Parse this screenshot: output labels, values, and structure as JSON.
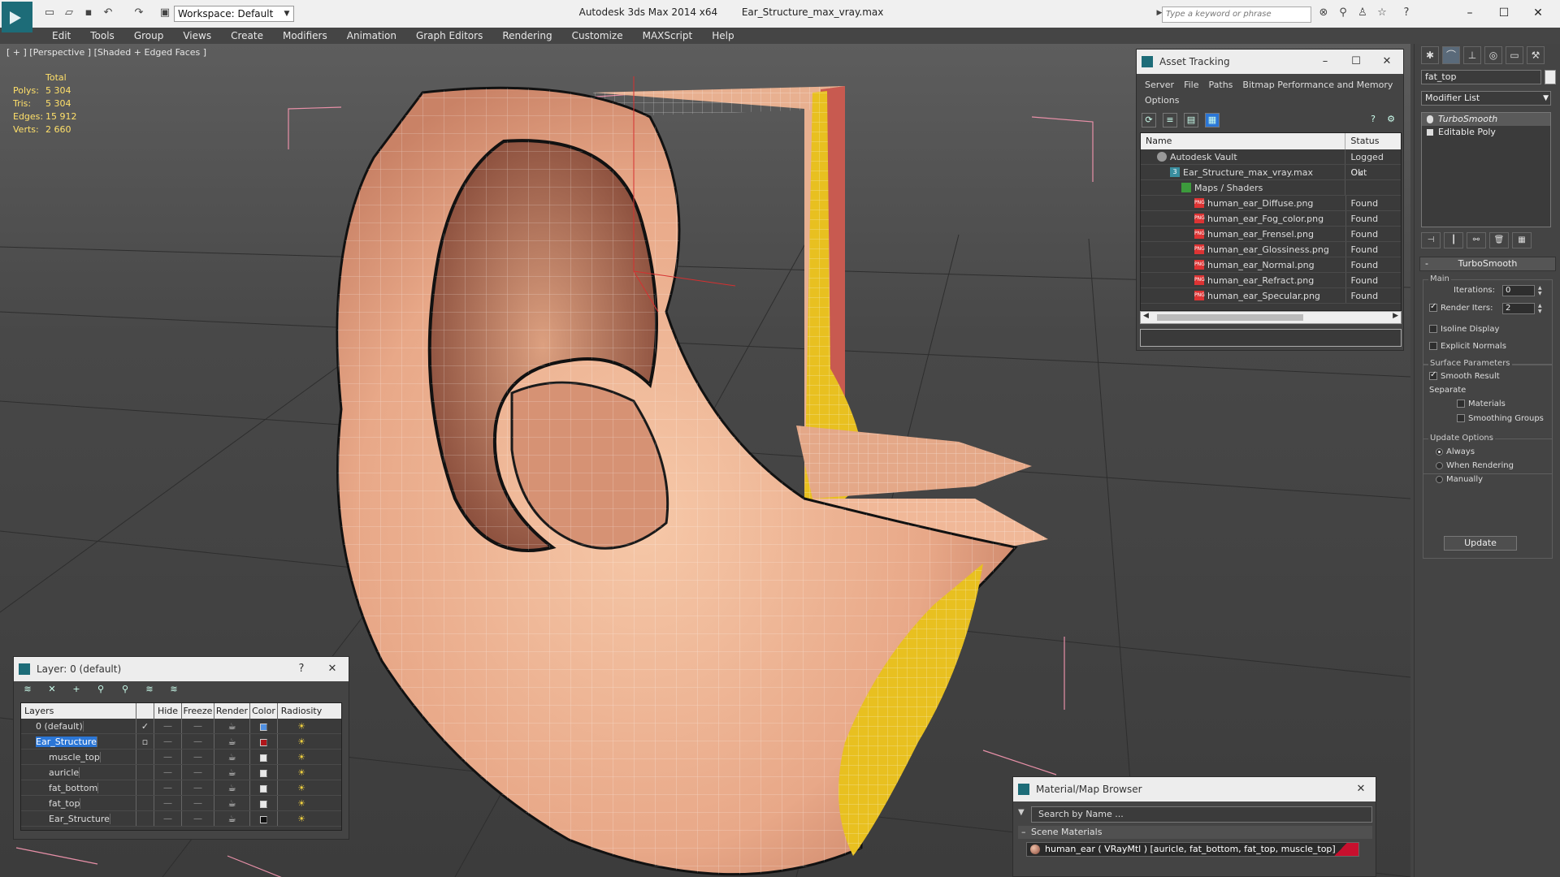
{
  "titlebar": {
    "app_name": "Autodesk 3ds Max  2014 x64",
    "file_name": "Ear_Structure_max_vray.max",
    "workspace": "Workspace: Default",
    "search_placeholder": "Type a keyword or phrase"
  },
  "menu": [
    "Edit",
    "Tools",
    "Group",
    "Views",
    "Create",
    "Modifiers",
    "Animation",
    "Graph Editors",
    "Rendering",
    "Customize",
    "MAXScript",
    "Help"
  ],
  "viewport": {
    "label": "[ + ] [Perspective ] [Shaded + Edged Faces ]",
    "stats_header": "Total",
    "stats": [
      {
        "key": "Polys:",
        "value": "5 304"
      },
      {
        "key": "Tris:",
        "value": "5 304"
      },
      {
        "key": "Edges:",
        "value": "15 912"
      },
      {
        "key": "Verts:",
        "value": "2 660"
      }
    ]
  },
  "asset_tracking": {
    "title": "Asset Tracking",
    "menu": [
      "Server",
      "File",
      "Paths",
      "Bitmap Performance and Memory",
      "Options"
    ],
    "columns": {
      "name": "Name",
      "status": "Status"
    },
    "rows": [
      {
        "name": "Autodesk Vault",
        "status": "Logged Out",
        "indent": 1,
        "icon": "vault"
      },
      {
        "name": "Ear_Structure_max_vray.max",
        "status": "Ok",
        "indent": 2,
        "icon": "max"
      },
      {
        "name": "Maps / Shaders",
        "status": "",
        "indent": 3,
        "icon": "maps"
      },
      {
        "name": "human_ear_Diffuse.png",
        "status": "Found",
        "indent": 4,
        "icon": "png"
      },
      {
        "name": "human_ear_Fog_color.png",
        "status": "Found",
        "indent": 4,
        "icon": "png"
      },
      {
        "name": "human_ear_Frensel.png",
        "status": "Found",
        "indent": 4,
        "icon": "png"
      },
      {
        "name": "human_ear_Glossiness.png",
        "status": "Found",
        "indent": 4,
        "icon": "png"
      },
      {
        "name": "human_ear_Normal.png",
        "status": "Found",
        "indent": 4,
        "icon": "png"
      },
      {
        "name": "human_ear_Refract.png",
        "status": "Found",
        "indent": 4,
        "icon": "png"
      },
      {
        "name": "human_ear_Specular.png",
        "status": "Found",
        "indent": 4,
        "icon": "png"
      }
    ]
  },
  "layers": {
    "title": "Layer: 0 (default)",
    "help": "?",
    "columns": {
      "layers": "Layers",
      "hide": "Hide",
      "freeze": "Freeze",
      "render": "Render",
      "color": "Color",
      "radiosity": "Radiosity"
    },
    "rows": [
      {
        "name": "0 (default)",
        "color": "#4f8fe0",
        "checked": true,
        "selected": false,
        "indent": 1
      },
      {
        "name": "Ear_Structure",
        "color": "#b0161a",
        "checked": false,
        "selected": true,
        "indent": 1
      },
      {
        "name": "muscle_top",
        "color": "#e8e8e8",
        "checked": false,
        "selected": false,
        "indent": 2
      },
      {
        "name": "auricle",
        "color": "#e8e8e8",
        "checked": false,
        "selected": false,
        "indent": 2
      },
      {
        "name": "fat_bottom",
        "color": "#e8e8e8",
        "checked": false,
        "selected": false,
        "indent": 2
      },
      {
        "name": "fat_top",
        "color": "#e8e8e8",
        "checked": false,
        "selected": false,
        "indent": 2
      },
      {
        "name": "Ear_Structure",
        "color": "#111111",
        "checked": false,
        "selected": false,
        "indent": 2
      }
    ]
  },
  "material_browser": {
    "title": "Material/Map Browser",
    "search_placeholder": "Search by Name ...",
    "section": "Scene Materials",
    "item": "human_ear  ( VRayMtl )  [auricle, fat_bottom, fat_top, muscle_top]"
  },
  "command_panel": {
    "object_name": "fat_top",
    "modifier_list": "Modifier List",
    "stack": [
      "TurboSmooth",
      "Editable Poly"
    ],
    "rollout_title": "TurboSmooth",
    "main_group": "Main",
    "iterations_label": "Iterations:",
    "iterations_value": "0",
    "render_iters_label": "Render Iters:",
    "render_iters_value": "2",
    "render_iters_checked": true,
    "isoline_label": "Isoline Display",
    "explicit_normals_label": "Explicit Normals",
    "surface_group": "Surface Parameters",
    "smooth_result_label": "Smooth Result",
    "separate_label": "Separate",
    "materials_label": "Materials",
    "smoothing_groups_label": "Smoothing Groups",
    "update_group": "Update Options",
    "always_label": "Always",
    "when_rendering_label": "When Rendering",
    "manually_label": "Manually",
    "update_button": "Update"
  },
  "colors": {
    "selection_blue": "#2b76d6",
    "stats_yellow": "#ffe06a",
    "skin": "#f0b898",
    "fat_yellow": "#e8c020"
  }
}
